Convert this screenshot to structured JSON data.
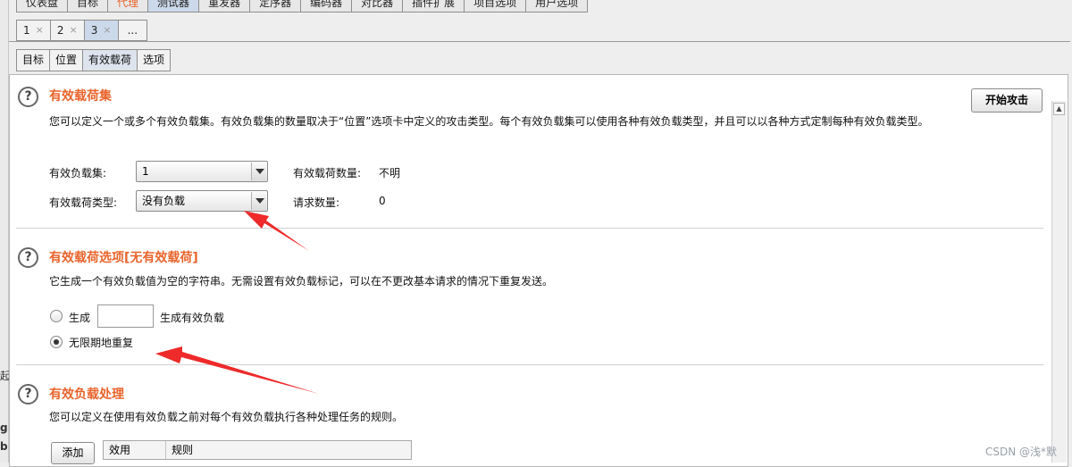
{
  "top_tabs": [
    "仪表盘",
    "目标",
    "代理",
    "测试器",
    "重发器",
    "定序器",
    "编码器",
    "对比器",
    "插件扩展",
    "项目选项",
    "用户选项"
  ],
  "attack_tabs": [
    {
      "label": "1",
      "close": "×"
    },
    {
      "label": "2",
      "close": "×"
    },
    {
      "label": "3",
      "close": "×"
    },
    {
      "label": "...",
      "close": ""
    }
  ],
  "section_tabs": [
    "目标",
    "位置",
    "有效载荷",
    "选项"
  ],
  "start_attack_label": "开始攻击",
  "payload_sets": {
    "title": "有效载荷集",
    "description": "您可以定义一个或多个有效负载集。有效负载集的数量取决于“位置”选项卡中定义的攻击类型。每个有效负载集可以使用各种有效负载类型，并且可以以各种方式定制每种有效负载类型。",
    "set_label": "有效负载集:",
    "set_value": "1",
    "count_label": "有效载荷数量:",
    "count_value": "不明",
    "type_label": "有效载荷类型:",
    "type_value": "没有负载",
    "requests_label": "请求数量:",
    "requests_value": "0"
  },
  "payload_options": {
    "title": "有效载荷选项[无有效载荷]",
    "description": "它生成一个有效负载值为空的字符串。无需设置有效负载标记，可以在不更改基本请求的情况下重复发送。",
    "generate_label": "生成",
    "generate_value": "",
    "generate_suffix": "生成有效负载",
    "indefinite_label": "无限期地重复",
    "selected": "indefinite"
  },
  "payload_processing": {
    "title": "有效负载处理",
    "description": "您可以定义在使用有效负载之前对每个有效负载执行各种处理任务的规则。",
    "add_label": "添加",
    "columns": [
      "效用",
      "规则"
    ]
  },
  "left_gutter_chars": [
    "起",
    "g",
    "b"
  ],
  "watermark": "CSDN @浅*默",
  "annotation_color": "#ee2a2a"
}
